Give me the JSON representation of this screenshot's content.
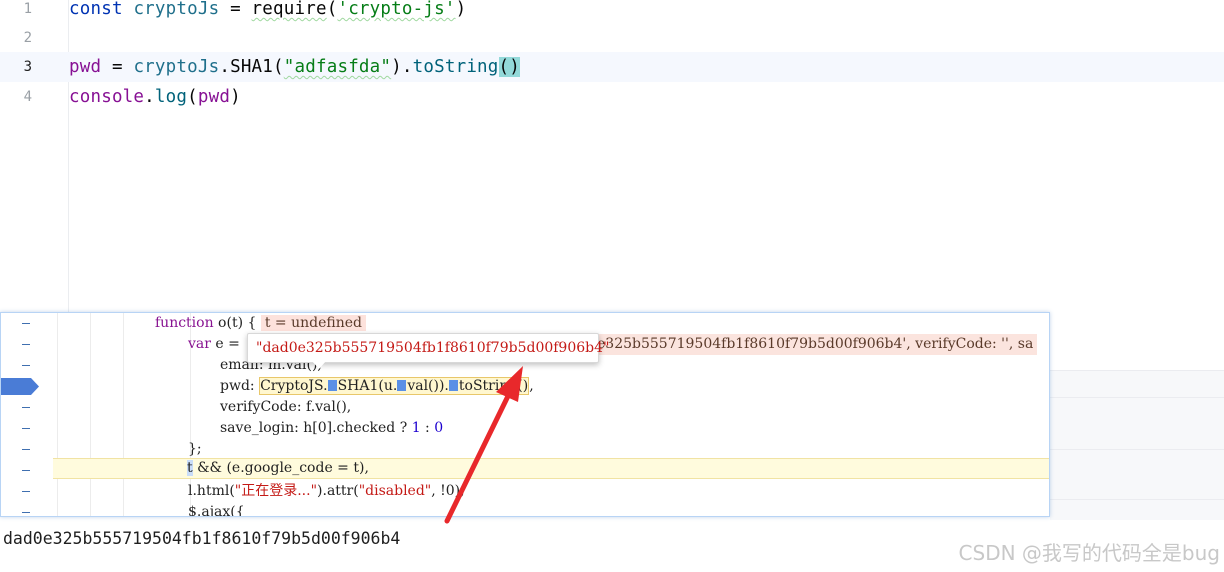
{
  "editor": {
    "lines": [
      {
        "number": "1",
        "tokens": {
          "kw": "const",
          "name": "cryptoJs",
          "eq": " = ",
          "fn": "require",
          "open": "(",
          "str": "'crypto-js'",
          "close": ")"
        }
      },
      {
        "number": "2"
      },
      {
        "number": "3",
        "tokens": {
          "var": "pwd",
          "eq": " = ",
          "obj": "cryptoJs",
          "dot1": ".",
          "method": "SHA1",
          "open": "(",
          "str": "\"adfasfda\"",
          "close": ")",
          "dot2": ".",
          "fn": "toString",
          "parens": "()"
        }
      },
      {
        "number": "4",
        "tokens": {
          "obj": "console",
          "dot": ".",
          "fn": "log",
          "open": "(",
          "arg": "pwd",
          "close": ")"
        }
      }
    ]
  },
  "devtools": {
    "lines": [
      {
        "kw": "function",
        "name": " o(t) { ",
        "inline": "t = undefined"
      },
      {
        "kw": "var",
        "rest": " e = ",
        "inline_tail": "e325b555719504fb1f8610f79b5d00f906b4', verifyCode: '', sa"
      },
      {
        "text": "email: m.val(),"
      },
      {
        "prop": "pwd: ",
        "call_a": "CryptoJS.",
        "call_b": "SHA1(u.",
        "call_c": "val()).",
        "call_d": "toString()",
        "tail": ","
      },
      {
        "text": "verifyCode: f.val(),"
      },
      {
        "text": "save_login: h[0].checked ? ",
        "n1": "1",
        "sep": " : ",
        "n2": "0"
      },
      {
        "text": "};"
      },
      {
        "t": "t",
        "rest": " && (e.google_code = t),"
      },
      {
        "a": "l.html(",
        "s1": "\"正在登录...\"",
        "b": ").attr(",
        "s2": "\"disabled\"",
        "c": ", !0),"
      },
      {
        "text": "$.ajax({"
      }
    ],
    "tooltip": "\"dad0e325b555719504fb1f8610f79b5d00f906b4\""
  },
  "console": {
    "output": "dad0e325b555719504fb1f8610f79b5d00f906b4"
  },
  "watermark": "CSDN @我写的代码全是bug",
  "colors": {
    "arrow": "#e8282b",
    "paused_line": "#fffbdd",
    "breakpoint": "#4a7cd6"
  }
}
